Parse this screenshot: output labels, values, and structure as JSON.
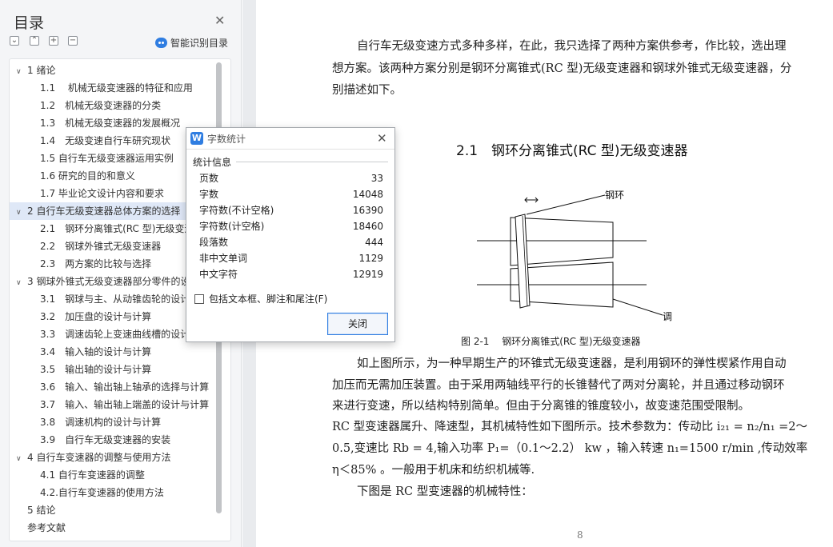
{
  "toc": {
    "title": "目录",
    "smart_label": "智能识别目录",
    "items": [
      {
        "label": "1 绪论",
        "caret": "∨",
        "selected": false
      },
      {
        "label": "1.1　 机械无级变速器的特征和应用",
        "caret": "",
        "selected": false
      },
      {
        "label": "1.2　机械无级变速器的分类",
        "caret": "",
        "selected": false
      },
      {
        "label": "1.3　机械无级变速器的发展概况",
        "caret": "",
        "selected": false
      },
      {
        "label": "1.4　无级变速自行车研究现状",
        "caret": "",
        "selected": false
      },
      {
        "label": "1.5 自行车无级变速器运用实例",
        "caret": "",
        "selected": false
      },
      {
        "label": "1.6 研究的目的和意义",
        "caret": "",
        "selected": false
      },
      {
        "label": "1.7 毕业论文设计内容和要求",
        "caret": "",
        "selected": false
      },
      {
        "label": "2 自行车无级变速器总体方案的选择",
        "caret": "∨",
        "selected": true
      },
      {
        "label": "2.1　钢环分离锥式(RC 型)无级变速器",
        "caret": "",
        "selected": false
      },
      {
        "label": "2.2　钢球外锥式无级变速器",
        "caret": "",
        "selected": false
      },
      {
        "label": "2.3　两方案的比较与选择",
        "caret": "",
        "selected": false
      },
      {
        "label": "3 钢球外锥式无级变速器部分零件的设计",
        "caret": "∨",
        "selected": false
      },
      {
        "label": "3.1　钢球与主、从动锥齿轮的设计",
        "caret": "",
        "selected": false
      },
      {
        "label": "3.2　加压盘的设计与计算",
        "caret": "",
        "selected": false
      },
      {
        "label": "3.3　调速齿轮上变速曲线槽的设计",
        "caret": "",
        "selected": false
      },
      {
        "label": "3.4　输入轴的设计与计算",
        "caret": "",
        "selected": false
      },
      {
        "label": "3.5　输出轴的设计与计算",
        "caret": "",
        "selected": false
      },
      {
        "label": "3.6　输入、输出轴上轴承的选择与计算",
        "caret": "",
        "selected": false
      },
      {
        "label": "3.7　输入、输出轴上端盖的设计与计算",
        "caret": "",
        "selected": false
      },
      {
        "label": "3.8　调速机构的设计与计算",
        "caret": "",
        "selected": false
      },
      {
        "label": "3.9　自行车无级变速器的安装",
        "caret": "",
        "selected": false
      },
      {
        "label": "4 自行车变速器的调整与使用方法",
        "caret": "∨",
        "selected": false
      },
      {
        "label": "4.1 自行车变速器的调整",
        "caret": "",
        "selected": false
      },
      {
        "label": "4.2.自行车变速器的使用方法",
        "caret": "",
        "selected": false
      },
      {
        "label": "5 结论",
        "caret": "",
        "selected": false
      },
      {
        "label": "参考文献",
        "caret": "",
        "selected": false
      }
    ]
  },
  "dialog": {
    "title": "字数统计",
    "section": "统计信息",
    "stats": [
      {
        "label": "页数",
        "value": "33"
      },
      {
        "label": "字数",
        "value": "14048"
      },
      {
        "label": "字符数(不计空格)",
        "value": "16390"
      },
      {
        "label": "字符数(计空格)",
        "value": "18460"
      },
      {
        "label": "段落数",
        "value": "444"
      },
      {
        "label": "非中文单词",
        "value": "1129"
      },
      {
        "label": "中文字符",
        "value": "12919"
      }
    ],
    "checkbox_label": "包括文本框、脚注和尾注(F)",
    "close_button": "关闭"
  },
  "document": {
    "lines": [
      "自行车无级变速方式多种多样，在此，我只选择了两种方案供参考，作比较，选出理",
      "想方案。该两种方案分别是钢环分离锥式(RC 型)无级变速器和钢球外锥式无级变速器，分",
      "别描述如下。"
    ],
    "heading": "2.1　钢环分离锥式(RC 型)无级变速器",
    "figure_labels": {
      "ring": "钢环",
      "cone": "调速锥轮"
    },
    "caption": "图 2-1　 钢环分离锥式(RC 型)无级变速器",
    "body_lines": [
      "如上图所示，为一种早期生产的环锥式无级变速器，是利用钢环的弹性楔紧作用自动",
      "加压而无需加压装置。由于采用两轴线平行的长锥替代了两对分离轮，并且通过移动钢环",
      "来进行变速，所以结构特别简单。但由于分离锥的锥度较小，故变速范围受限制。",
      "RC 型变速器属升、降速型，其机械特性如下图所示。技术参数为：传动比 i₂₁ = n₂/n₁ =2～",
      "0.5,变速比 Rb = 4,输入功率 P₁=（0.1～2.2） kw ，输入转速 n₁=1500 r/min ,传动效率",
      "η＜85% 。一般用于机床和纺织机械等.",
      "下图是 RC 型变速器的机械特性："
    ],
    "page_number": "8"
  }
}
